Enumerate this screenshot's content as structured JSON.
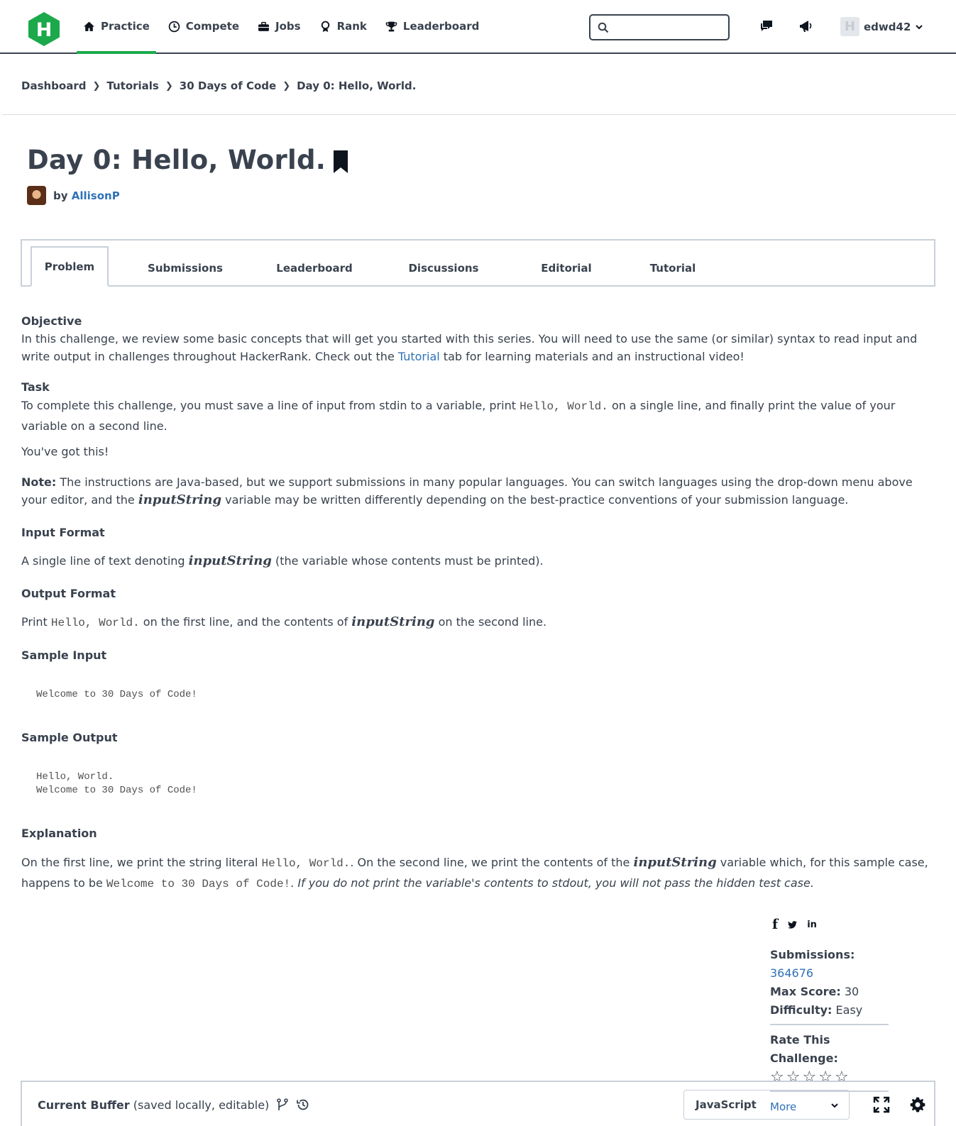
{
  "nav": {
    "logo_letter": "H",
    "items": [
      {
        "label": "Practice",
        "icon": "home-icon"
      },
      {
        "label": "Compete",
        "icon": "clock-icon"
      },
      {
        "label": "Jobs",
        "icon": "briefcase-icon"
      },
      {
        "label": "Rank",
        "icon": "medal-icon"
      },
      {
        "label": "Leaderboard",
        "icon": "trophy-icon"
      }
    ],
    "search_placeholder": "",
    "user": {
      "name": "edwd42",
      "avatar_letter": "H"
    },
    "accent_color": "#1ba94c"
  },
  "breadcrumb": [
    "Dashboard",
    "Tutorials",
    "30 Days of Code",
    "Day 0: Hello, World."
  ],
  "challenge": {
    "title": "Day 0: Hello, World.",
    "by_label": "by",
    "author": "AllisonP"
  },
  "tabs": [
    "Problem",
    "Submissions",
    "Leaderboard",
    "Discussions",
    "Editorial",
    "Tutorial"
  ],
  "problem": {
    "objective_heading": "Objective",
    "objective_text_1": "In this challenge, we review some basic concepts that will get you started with this series. You will need to use the same (or similar) syntax to read input and write output in challenges throughout HackerRank. Check out the ",
    "objective_link": "Tutorial",
    "objective_text_2": " tab for learning materials and an instructional video!",
    "task_heading": "Task",
    "task_text_1": "To complete this challenge, you must save a line of input from stdin to a variable, print ",
    "task_code": "Hello, World.",
    "task_text_2": " on a single line, and finally print the value of your variable on a second line.",
    "encourage": "You've got this!",
    "note_label": "Note:",
    "note_text_1": " The instructions are Java-based, but we support submissions in many popular languages. You can switch languages using the drop-down menu above your editor, and the ",
    "var_name": "inputString",
    "note_text_2": " variable may be written differently depending on the best-practice conventions of your submission language.",
    "input_heading": "Input Format",
    "input_text_1": "A single line of text denoting ",
    "input_text_2": " (the variable whose contents must be printed).",
    "output_heading": "Output Format",
    "output_text_1": "Print ",
    "output_code": "Hello, World.",
    "output_text_2": " on the first line, and the contents of ",
    "output_text_3": " on the second line.",
    "sample_input_heading": "Sample Input",
    "sample_input": "Welcome to 30 Days of Code!",
    "sample_output_heading": "Sample Output",
    "sample_output_line1": "Hello, World.",
    "sample_output_line2": "Welcome to 30 Days of Code!",
    "explanation_heading": "Explanation",
    "expl_text_1": "On the first line, we print the string literal ",
    "expl_code_1": "Hello, World.",
    "expl_text_2": ". On the second line, we print the contents of the ",
    "expl_text_3": " variable which, for this sample case, happens to be ",
    "expl_code_2": "Welcome to 30 Days of Code!",
    "expl_text_4": ". ",
    "expl_italic": "If you do not print the variable's contents to stdout, you will not pass the hidden test case."
  },
  "share": {
    "facebook": "f",
    "twitter": "twitter-icon",
    "linkedin": "in"
  },
  "stats": {
    "submissions_label": "Submissions:",
    "submissions_value": "364676",
    "max_score_label": "Max Score:",
    "max_score_value": "30",
    "difficulty_label": "Difficulty:",
    "difficulty_value": "Easy",
    "rate_label": "Rate This Challenge:",
    "rating_stars_filled": 0,
    "rating_stars_total": 5,
    "more_label": "More"
  },
  "editor": {
    "buffer_label": "Current Buffer",
    "buffer_note": "(saved locally, editable)",
    "language": "JavaScript"
  }
}
